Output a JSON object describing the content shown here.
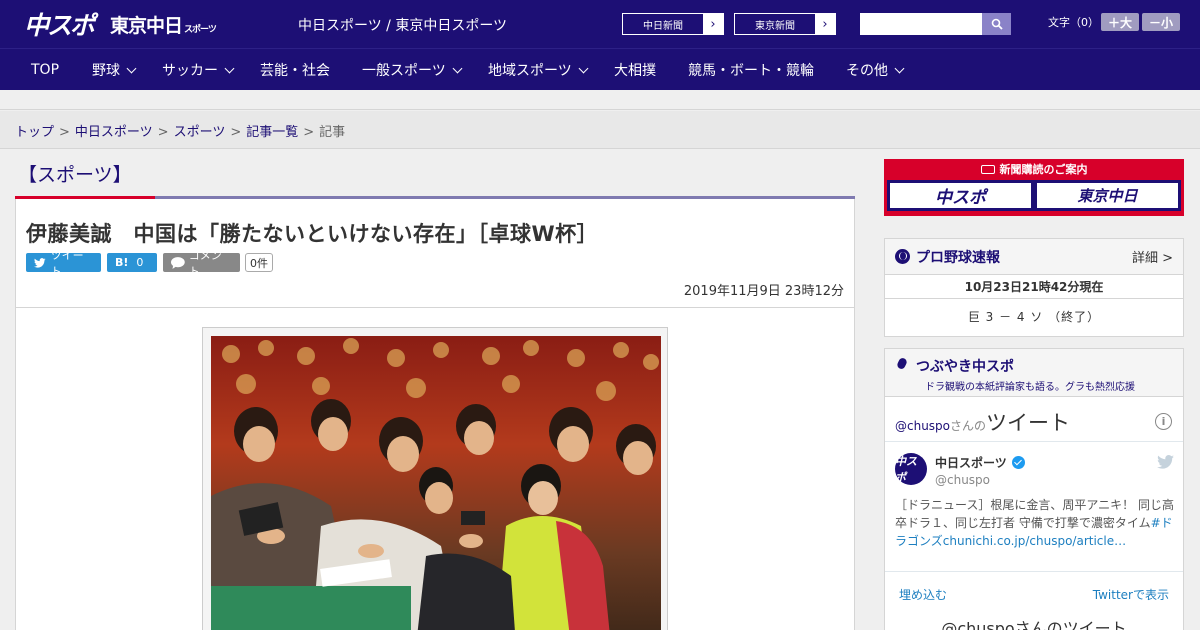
{
  "header": {
    "logo_chuspo": "中スポ",
    "logo_tokyo": "東京中日",
    "logo_tokyo_small": "スポーツ",
    "site_title": "中日スポーツ / 東京中日スポーツ",
    "ext_links": [
      {
        "label": "中日新聞"
      },
      {
        "label": "東京新聞"
      }
    ],
    "search_placeholder": "",
    "fontsize_label": "文字（0）",
    "fontsize_up": "＋大",
    "fontsize_down": "－小"
  },
  "nav": {
    "items": [
      {
        "label": "TOP"
      },
      {
        "label": "野球"
      },
      {
        "label": "サッカー"
      },
      {
        "label": "芸能・社会"
      },
      {
        "label": "一般スポーツ"
      },
      {
        "label": "地域スポーツ"
      },
      {
        "label": "大相撲"
      },
      {
        "label": "競馬・ボート・競輪"
      },
      {
        "label": "その他"
      }
    ]
  },
  "breadcrumb": {
    "items": [
      "トップ",
      "中日スポーツ",
      "スポーツ",
      "記事一覧"
    ],
    "current": "記事",
    "sep": ">"
  },
  "article": {
    "section": "【スポーツ】",
    "headline": "伊藤美誠　中国は「勝たないといけない存在」［卓球W杯］",
    "share_tweet": "ツイート",
    "share_hatena": "B!",
    "share_hatena_count": "0",
    "share_comment": "コメント",
    "comment_count": "0件",
    "date": "2019年11月9日 23時12分"
  },
  "sidebar": {
    "subscribe_title": "新聞購読のご案内",
    "subscribe_left": "中スポ",
    "subscribe_right": "東京中日",
    "baseball": {
      "title": "プロ野球速報",
      "more": "詳細 >",
      "time": "10月23日21時42分現在",
      "game": "巨 3 － 4 ソ （終了）"
    },
    "tweets": {
      "title": "つぶやき中スポ",
      "subtitle": "ドラ観戦の本紙評論家も語る。グラも熱烈応援",
      "widget_account": "@chuspo",
      "widget_san": "さんの",
      "widget_tweet": "ツイート",
      "avatar_text": "中スポ",
      "name": "中日スポーツ",
      "handle": "@chuspo",
      "text": "［ドラニュース］根尾に金言、周平アニキ！ 同じ高卒ドラ１、同じ左打者 守備で打撃で濃密タイム",
      "hashtag": "#ドラゴンズ",
      "link": "chunichi.co.jp/chuspo/article…",
      "embed": "埋め込む",
      "view_on": "Twitterで表示",
      "more_tweets": "@chuspoさんのツイート"
    }
  },
  "colors": {
    "brand_navy": "#1d0f75",
    "accent_red": "#d7002a",
    "twitter_blue": "#2b94d6"
  }
}
